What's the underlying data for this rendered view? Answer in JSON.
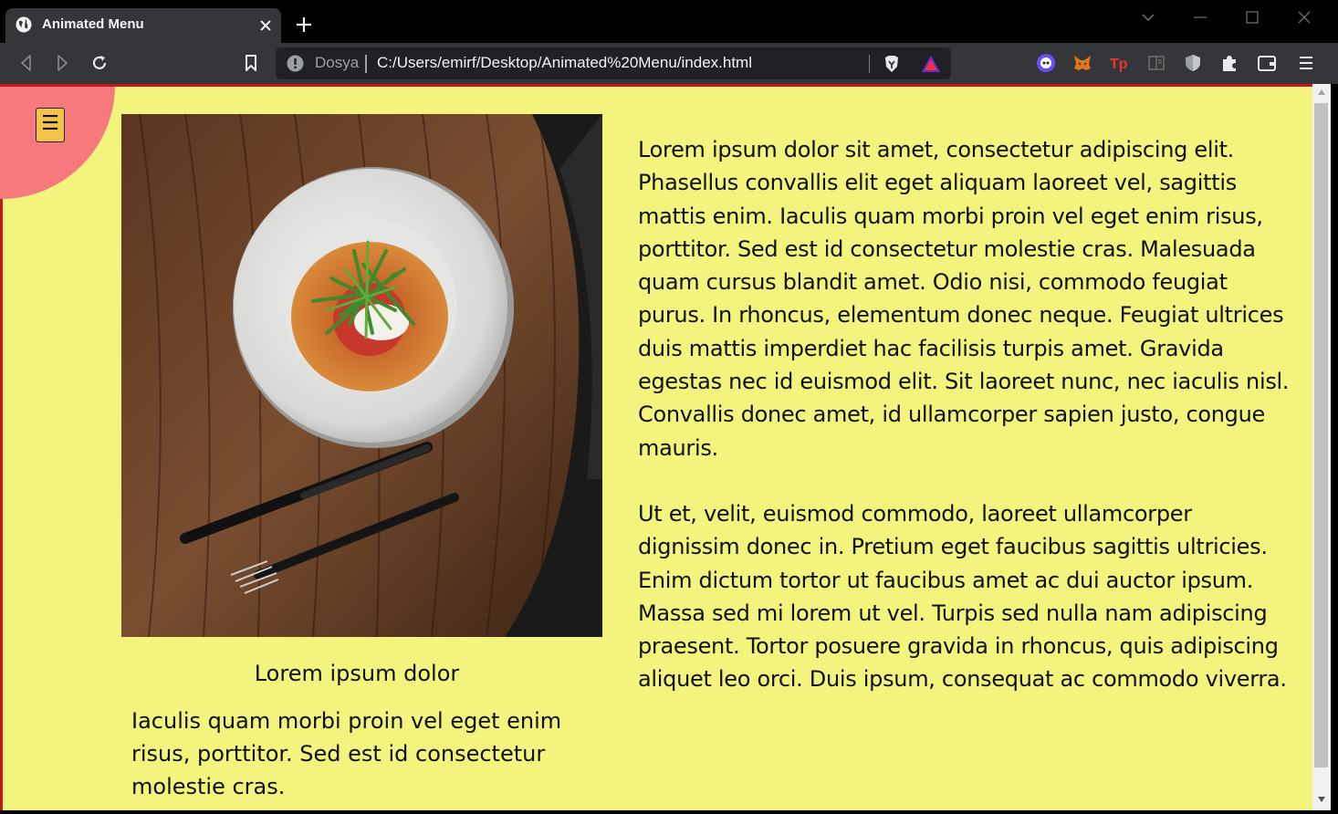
{
  "browser": {
    "tab_title": "Animated Menu",
    "omnibox": {
      "site_label": "Dosya",
      "url": "C:/Users/emirf/Desktop/Animated%20Menu/index.html"
    },
    "toolbar_icons": [
      "back-icon",
      "forward-icon",
      "reload-icon",
      "bookmark-icon",
      "info-icon",
      "brave-shields-icon",
      "brave-rewards-icon",
      "extension-mascot-icon",
      "metamask-icon",
      "tp-extension-icon",
      "reading-list-icon",
      "shield-icon",
      "puzzle-extensions-icon",
      "wallet-icon",
      "menu-icon"
    ]
  },
  "page": {
    "menu_toggle_glyph": "☰",
    "caption_title": "Lorem ipsum dolor",
    "caption_text": "Iaculis quam morbi proin vel eget enim risus, porttitor. Sed est id consectetur molestie cras.",
    "paragraph_1": "Lorem ipsum dolor sit amet, consectetur adipiscing elit. Phasellus convallis elit eget aliquam laoreet vel, sagittis mattis enim. Iaculis quam morbi proin vel eget enim risus, porttitor. Sed est id consectetur molestie cras. Malesuada quam cursus blandit amet. Odio nisi, commodo feugiat purus. In rhoncus, elementum donec neque. Feugiat ultrices duis mattis imperdiet hac facilisis turpis amet. Gravida egestas nec id euismod elit. Sit laoreet nunc, nec iaculis nisl. Convallis donec amet, id ullamcorper sapien justo, congue mauris.",
    "paragraph_2": "Ut et, velit, euismod commodo, laoreet ullamcorper dignissim donec in. Pretium eget faucibus sagittis ultricies. Enim dictum tortor ut faucibus amet ac dui auctor ipsum. Massa sed mi lorem ut vel. Turpis sed nulla nam adipiscing praesent. Tortor posuere gravida in rhoncus, quis adipiscing aliquet leo orci. Duis ipsum, consequat ac commodo viverra.",
    "colors": {
      "background": "#f3f47e",
      "menu_circle": "#f67a7d",
      "menu_button": "#f4c34a"
    }
  }
}
